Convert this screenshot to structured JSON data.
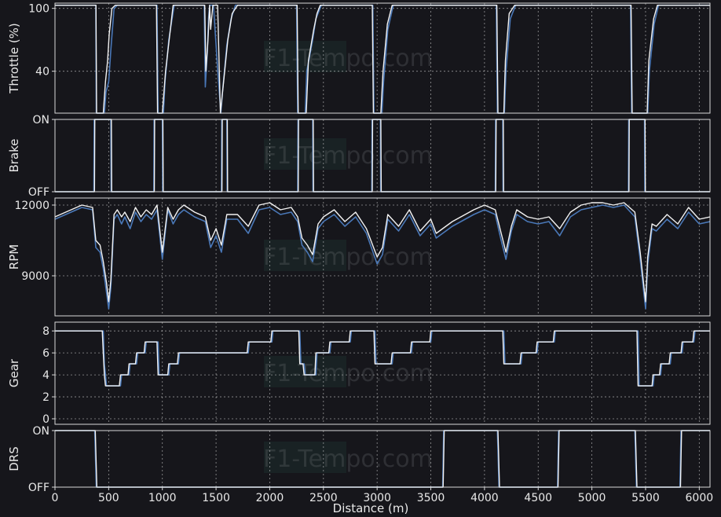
{
  "colors": {
    "background": "#16161b",
    "series_white": "#f2f2f2",
    "series_blue": "#4a78b8",
    "grid": "#bfbfbf",
    "text": "#e8e8e8",
    "watermark_bg": "#1f3a36"
  },
  "watermark": "F1-Tempo.com",
  "chart_data": [
    {
      "type": "line",
      "id": "throttle",
      "ylabel": "Throttle (%)",
      "ylim": [
        0,
        105
      ],
      "yticks": [
        40,
        100
      ],
      "grid": true,
      "series": [
        {
          "x": [
            0,
            380,
            385,
            460,
            475,
            500,
            520,
            550,
            580,
            600,
            640,
            950,
            960,
            1010,
            1025,
            1060,
            1110,
            1150,
            1390,
            1400,
            1420,
            1430,
            1440,
            1450,
            1475,
            1520,
            1545,
            1560,
            1600,
            1640,
            1680,
            1720,
            1760,
            1790,
            2250,
            2260,
            2330,
            2345,
            2400,
            2430,
            2480,
            2520,
            2560,
            2600,
            2650,
            2650,
            2960,
            2970,
            3045,
            3060,
            3100,
            3150,
            3180,
            4110,
            4120,
            4185,
            4200,
            4240,
            4290,
            5360,
            5370,
            5520,
            5535,
            5580,
            5620,
            6100
          ],
          "y": [
            103,
            103,
            0,
            0,
            20,
            30,
            60,
            100,
            103,
            103,
            103,
            103,
            0,
            0,
            30,
            70,
            103,
            103,
            103,
            25,
            60,
            90,
            103,
            103,
            103,
            35,
            0,
            20,
            65,
            90,
            103,
            103,
            103,
            103,
            103,
            0,
            0,
            40,
            70,
            90,
            103,
            103,
            103,
            103,
            103,
            103,
            103,
            0,
            0,
            30,
            80,
            103,
            103,
            103,
            0,
            0,
            40,
            90,
            103,
            103,
            0,
            0,
            40,
            85,
            103,
            103
          ]
        },
        {
          "x": [
            0,
            382,
            388,
            450,
            470,
            490,
            505,
            530,
            560,
            600,
            945,
            955,
            1000,
            1030,
            1080,
            1100,
            1395,
            1405,
            1425,
            1440,
            1450,
            1470,
            1515,
            1540,
            1570,
            1610,
            1650,
            1700,
            1760,
            2255,
            2265,
            2340,
            2360,
            2410,
            2440,
            2470,
            2500,
            2560,
            2955,
            2965,
            3035,
            3055,
            3095,
            3140,
            3180,
            4115,
            4125,
            4180,
            4195,
            4230,
            4280,
            5365,
            5375,
            5515,
            5530,
            5575,
            5610,
            6100
          ],
          "y": [
            103,
            103,
            0,
            0,
            30,
            50,
            75,
            100,
            103,
            103,
            103,
            0,
            0,
            40,
            85,
            103,
            103,
            40,
            70,
            103,
            80,
            103,
            103,
            0,
            30,
            70,
            95,
            103,
            103,
            103,
            0,
            0,
            50,
            80,
            95,
            103,
            103,
            103,
            103,
            0,
            0,
            40,
            85,
            103,
            103,
            103,
            0,
            0,
            50,
            95,
            103,
            103,
            0,
            0,
            50,
            90,
            103,
            103
          ]
        }
      ]
    },
    {
      "type": "line",
      "id": "brake",
      "ylabel": "Brake",
      "ylim": [
        0,
        1
      ],
      "yticks": [
        "OFF",
        "ON"
      ],
      "grid": true,
      "series": [
        {
          "x": [
            0,
            362,
            365,
            520,
            523,
            920,
            923,
            1000,
            1003,
            1550,
            1553,
            1600,
            1603,
            2260,
            2263,
            2400,
            2403,
            2950,
            2953,
            3030,
            3033,
            4100,
            4103,
            4170,
            4173,
            5340,
            5343,
            5490,
            5493,
            6100
          ],
          "y": [
            0,
            0,
            1,
            1,
            0,
            0,
            1,
            1,
            0,
            0,
            1,
            1,
            0,
            0,
            1,
            1,
            0,
            0,
            1,
            1,
            0,
            0,
            1,
            1,
            0,
            0,
            1,
            1,
            0,
            0
          ]
        },
        {
          "x": [
            0,
            368,
            371,
            525,
            528,
            925,
            928,
            1005,
            1008,
            1555,
            1558,
            1605,
            1608,
            2265,
            2268,
            2405,
            2408,
            2955,
            2958,
            3035,
            3038,
            4105,
            4108,
            4175,
            4178,
            5345,
            5348,
            5495,
            5498,
            6100
          ],
          "y": [
            0,
            0,
            1,
            1,
            0,
            0,
            1,
            1,
            0,
            0,
            1,
            1,
            0,
            0,
            1,
            1,
            0,
            0,
            1,
            1,
            0,
            0,
            1,
            1,
            0,
            0,
            1,
            1,
            0,
            0
          ]
        }
      ]
    },
    {
      "type": "line",
      "id": "rpm",
      "ylabel": "RPM",
      "ylim": [
        7300,
        12300
      ],
      "yticks": [
        9000,
        12000
      ],
      "grid": true,
      "series": [
        {
          "x": [
            0,
            150,
            250,
            350,
            380,
            420,
            450,
            480,
            500,
            520,
            550,
            580,
            620,
            650,
            700,
            750,
            800,
            850,
            900,
            950,
            1000,
            1050,
            1100,
            1150,
            1200,
            1300,
            1400,
            1450,
            1500,
            1550,
            1600,
            1700,
            1800,
            1900,
            2000,
            2100,
            2200,
            2260,
            2300,
            2350,
            2400,
            2450,
            2500,
            2600,
            2700,
            2800,
            2900,
            3000,
            3050,
            3100,
            3200,
            3300,
            3400,
            3500,
            3550,
            3700,
            3900,
            4000,
            4100,
            4150,
            4200,
            4250,
            4300,
            4400,
            4500,
            4600,
            4700,
            4800,
            4900,
            5000,
            5100,
            5200,
            5300,
            5400,
            5450,
            5500,
            5520,
            5560,
            5600,
            5700,
            5800,
            5900,
            6000,
            6100
          ],
          "y": [
            11400,
            11700,
            11900,
            11800,
            10200,
            10000,
            9300,
            8300,
            7600,
            8500,
            11400,
            11600,
            11200,
            11500,
            11000,
            11700,
            11300,
            11600,
            11400,
            11800,
            9700,
            11800,
            11200,
            11600,
            11800,
            11500,
            11300,
            10200,
            10700,
            10000,
            11400,
            11400,
            10800,
            11800,
            11900,
            11600,
            11700,
            11300,
            10300,
            10000,
            9600,
            11000,
            11300,
            11600,
            11100,
            11500,
            10800,
            9500,
            9900,
            11400,
            10900,
            11600,
            10700,
            11200,
            10600,
            11100,
            11600,
            11800,
            11600,
            10600,
            9700,
            10900,
            11600,
            11300,
            11200,
            11300,
            10700,
            11500,
            11800,
            11900,
            12000,
            11900,
            12000,
            11500,
            9700,
            7600,
            9500,
            11000,
            10900,
            11400,
            11000,
            11700,
            11200,
            11300
          ]
        },
        {
          "x": [
            0,
            150,
            250,
            350,
            380,
            420,
            450,
            480,
            500,
            520,
            550,
            580,
            620,
            650,
            700,
            750,
            800,
            850,
            900,
            950,
            1000,
            1050,
            1100,
            1150,
            1200,
            1300,
            1400,
            1450,
            1500,
            1550,
            1600,
            1700,
            1800,
            1900,
            2000,
            2100,
            2200,
            2260,
            2300,
            2350,
            2400,
            2450,
            2500,
            2600,
            2700,
            2800,
            2900,
            3000,
            3050,
            3100,
            3200,
            3300,
            3400,
            3500,
            3550,
            3700,
            3900,
            4000,
            4100,
            4150,
            4200,
            4250,
            4300,
            4400,
            4500,
            4600,
            4700,
            4800,
            4900,
            5000,
            5100,
            5200,
            5300,
            5400,
            5450,
            5500,
            5520,
            5560,
            5600,
            5700,
            5800,
            5900,
            6000,
            6100
          ],
          "y": [
            11500,
            11800,
            12000,
            11900,
            10500,
            10300,
            9600,
            8700,
            7900,
            8800,
            11600,
            11800,
            11500,
            11700,
            11300,
            11900,
            11500,
            11800,
            11600,
            12000,
            10000,
            11900,
            11400,
            11800,
            12000,
            11700,
            11500,
            10500,
            11000,
            10300,
            11600,
            11600,
            11100,
            12000,
            12100,
            11800,
            11900,
            11500,
            10600,
            10300,
            9900,
            11200,
            11500,
            11800,
            11300,
            11700,
            11000,
            9800,
            10200,
            11600,
            11100,
            11800,
            10900,
            11400,
            10800,
            11300,
            11800,
            12000,
            11800,
            10900,
            10000,
            11100,
            11800,
            11500,
            11400,
            11500,
            11000,
            11700,
            12000,
            12100,
            12100,
            12000,
            12100,
            11700,
            10000,
            7900,
            9800,
            11200,
            11100,
            11600,
            11200,
            11900,
            11400,
            11500
          ]
        }
      ]
    },
    {
      "type": "line",
      "id": "gear",
      "ylabel": "Gear",
      "ylim": [
        -0.5,
        8.8
      ],
      "yticks": [
        0,
        2,
        4,
        6,
        8
      ],
      "grid": true,
      "series": [
        {
          "x": [
            0,
            450,
            460,
            470,
            480,
            610,
            620,
            690,
            700,
            760,
            770,
            840,
            850,
            960,
            970,
            1060,
            1070,
            1150,
            1160,
            1800,
            1810,
            2020,
            2030,
            2280,
            2290,
            2320,
            2330,
            2430,
            2440,
            2560,
            2570,
            2750,
            2760,
            2980,
            2990,
            3140,
            3150,
            3320,
            3330,
            3500,
            3510,
            4180,
            4190,
            4340,
            4350,
            4490,
            4500,
            4650,
            4660,
            5430,
            5440,
            5570,
            5580,
            5640,
            5650,
            5730,
            5740,
            5840,
            5850,
            5950,
            5960,
            6060,
            6070,
            6100
          ],
          "y": [
            8,
            8,
            5,
            4,
            3,
            3,
            4,
            4,
            5,
            5,
            6,
            6,
            7,
            7,
            4,
            4,
            5,
            5,
            6,
            6,
            7,
            7,
            8,
            8,
            5,
            5,
            4,
            4,
            6,
            6,
            7,
            7,
            8,
            8,
            5,
            5,
            6,
            6,
            7,
            7,
            8,
            8,
            5,
            5,
            6,
            6,
            7,
            7,
            8,
            8,
            3,
            3,
            4,
            4,
            5,
            5,
            6,
            6,
            7,
            7,
            8,
            8,
            8,
            8
          ]
        },
        {
          "x": [
            0,
            440,
            450,
            460,
            470,
            600,
            610,
            680,
            690,
            750,
            760,
            830,
            840,
            950,
            960,
            1050,
            1060,
            1140,
            1150,
            1790,
            1800,
            2010,
            2020,
            2270,
            2280,
            2310,
            2320,
            2420,
            2430,
            2550,
            2560,
            2740,
            2750,
            2970,
            2980,
            3130,
            3140,
            3310,
            3320,
            3490,
            3500,
            4170,
            4180,
            4330,
            4340,
            4480,
            4490,
            4640,
            4650,
            5420,
            5430,
            5560,
            5570,
            5630,
            5640,
            5720,
            5730,
            5830,
            5840,
            5940,
            5950,
            6050,
            6060,
            6100
          ],
          "y": [
            8,
            8,
            6,
            4,
            3,
            3,
            4,
            4,
            5,
            5,
            6,
            6,
            7,
            7,
            4,
            4,
            5,
            5,
            6,
            6,
            7,
            7,
            8,
            8,
            5,
            5,
            4,
            4,
            6,
            6,
            7,
            7,
            8,
            8,
            5,
            5,
            6,
            6,
            7,
            7,
            8,
            8,
            5,
            5,
            6,
            6,
            7,
            7,
            8,
            8,
            3,
            3,
            4,
            4,
            5,
            5,
            6,
            6,
            7,
            7,
            8,
            8,
            8,
            8
          ]
        }
      ]
    },
    {
      "type": "line",
      "id": "drs",
      "ylabel": "DRS",
      "ylim": [
        0,
        1
      ],
      "yticks": [
        "OFF",
        "ON"
      ],
      "xlabel": "Distance (m)",
      "xlim": [
        0,
        6100
      ],
      "xticks": [
        0,
        500,
        1000,
        1500,
        2000,
        2500,
        3000,
        3500,
        4000,
        4500,
        5000,
        5500,
        6000
      ],
      "grid": true,
      "series": [
        {
          "x": [
            0,
            370,
            385,
            3610,
            3620,
            4120,
            4135,
            4680,
            4690,
            5400,
            5415,
            5820,
            5830,
            6100
          ],
          "y": [
            1,
            1,
            0,
            0,
            1,
            1,
            0,
            0,
            1,
            1,
            0,
            0,
            1,
            1
          ]
        },
        {
          "x": [
            0,
            375,
            390,
            3615,
            3625,
            4125,
            4140,
            4685,
            4695,
            5405,
            5420,
            5825,
            5835,
            6100
          ],
          "y": [
            1,
            1,
            0,
            0,
            1,
            1,
            0,
            0,
            1,
            1,
            0,
            0,
            1,
            1
          ]
        }
      ]
    }
  ]
}
